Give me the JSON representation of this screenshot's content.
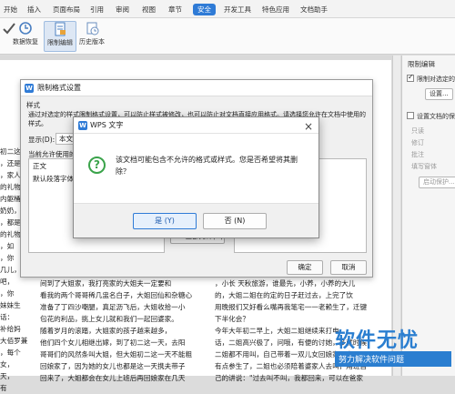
{
  "ribbon": {
    "tabs": [
      "开始",
      "插入",
      "页面布局",
      "引用",
      "审阅",
      "视图",
      "章节",
      "安全",
      "开发工具",
      "特色应用",
      "文档助手"
    ],
    "active_tab": "安全",
    "buttons": {
      "data_restore": "数据恢复",
      "restrict_edit": "限制编辑",
      "history": "历史版本"
    },
    "accent": "#2f7bd6"
  },
  "document": {
    "left_col": [
      "初二这",
      "，还是",
      "，家人",
      "的礼物",
      "",
      "内躯桶",
      "奶奶，",
      "，都是",
      "的礼物",
      "",
      "，如",
      "，你",
      "几儿，",
      "吧，",
      "，你",
      "妹妹生",
      "话：",
      "补给妈",
      "大佰罗兼",
      "，每个",
      "",
      "女，",
      "",
      "天，",
      "有"
    ],
    "mid_col": [
      "间到了大姐家，我打亮家的大姐夫一定要和",
      "看我的两个哥哥稀几盅名白子，大姐回仙和杂糖心",
      "准备了丁四沙嘲腿，真足沥飞后，大姐收拾一小",
      "包花的利品，挑上女儿就和我们一起回婆家。",
      "随着岁月的滚踏，大姐家的孩子越来越多，",
      "他们四个女儿相继出嫁，到了初二这一天，去阳",
      "哥哥们的风然条叫大姐，但大姐初二这一天不能粗",
      "回娘家了，因为她的女儿也都是这一天携夫带子",
      "回来了，大姐都会在女儿上班后再回娘家在几天"
    ],
    "right_col": [
      "，小长  天秋旅游，谁最先，小养，小养的大儿",
      "的，大姐二姐在的定的日子赶过去，上完了饮",
      "用晚报们又好看么嘴再我笔宅一一老赖生了，迁键",
      "下半化会？",
      "今年大年初二早上，大姐二姐继续来打电",
      "话，二姐高兴极了，问哦，有便的讨她，多就时候",
      "二姐都不用叫，自己带着一双儿女回娘家，自从",
      "有点参生了，二姐也必须陪着婆家人去叫，用班自",
      "己的讲说：\"过去叫不叫，我都回来，可以在爸家"
    ]
  },
  "right_pane": {
    "header": "限制编辑",
    "opt1": "限制对选定的样",
    "opt1_checked": true,
    "settings_btn": "设置...",
    "opt2": "设置文档的保护",
    "sub_opts": [
      "只读",
      "修订",
      "批注",
      "填写窗体"
    ],
    "protect_btn": "启动保护..."
  },
  "restrict_dialog": {
    "title": "限制格式设置",
    "group_label": "样式",
    "desc_line1": "通过对选定的样式限制格式设置，可以防止样式被修改，也可以防止对文档直接应用格式。请选择您允许在文档中使用的",
    "desc_line2": "样式。",
    "show_label": "显示(D):",
    "show_value": "本文",
    "current_label": "当前允许使用的",
    "list_items": [
      "正文",
      "默认段落字体"
    ],
    "all_allow_btn": "<< 全部允许(O)",
    "ok_btn": "确定",
    "cancel_btn": "取消"
  },
  "confirm_dialog": {
    "app_title": "WPS 文字",
    "message": "该文档可能包含不允许的格式或样式。您是否希望将其删除？",
    "yes_btn": "是 (Y)",
    "no_btn": "否 (N)",
    "icon": "question-icon",
    "icon_color": "#3aa34a"
  },
  "watermark": {
    "title": "软件无忧",
    "subtitle": "努力解决软件问题"
  }
}
